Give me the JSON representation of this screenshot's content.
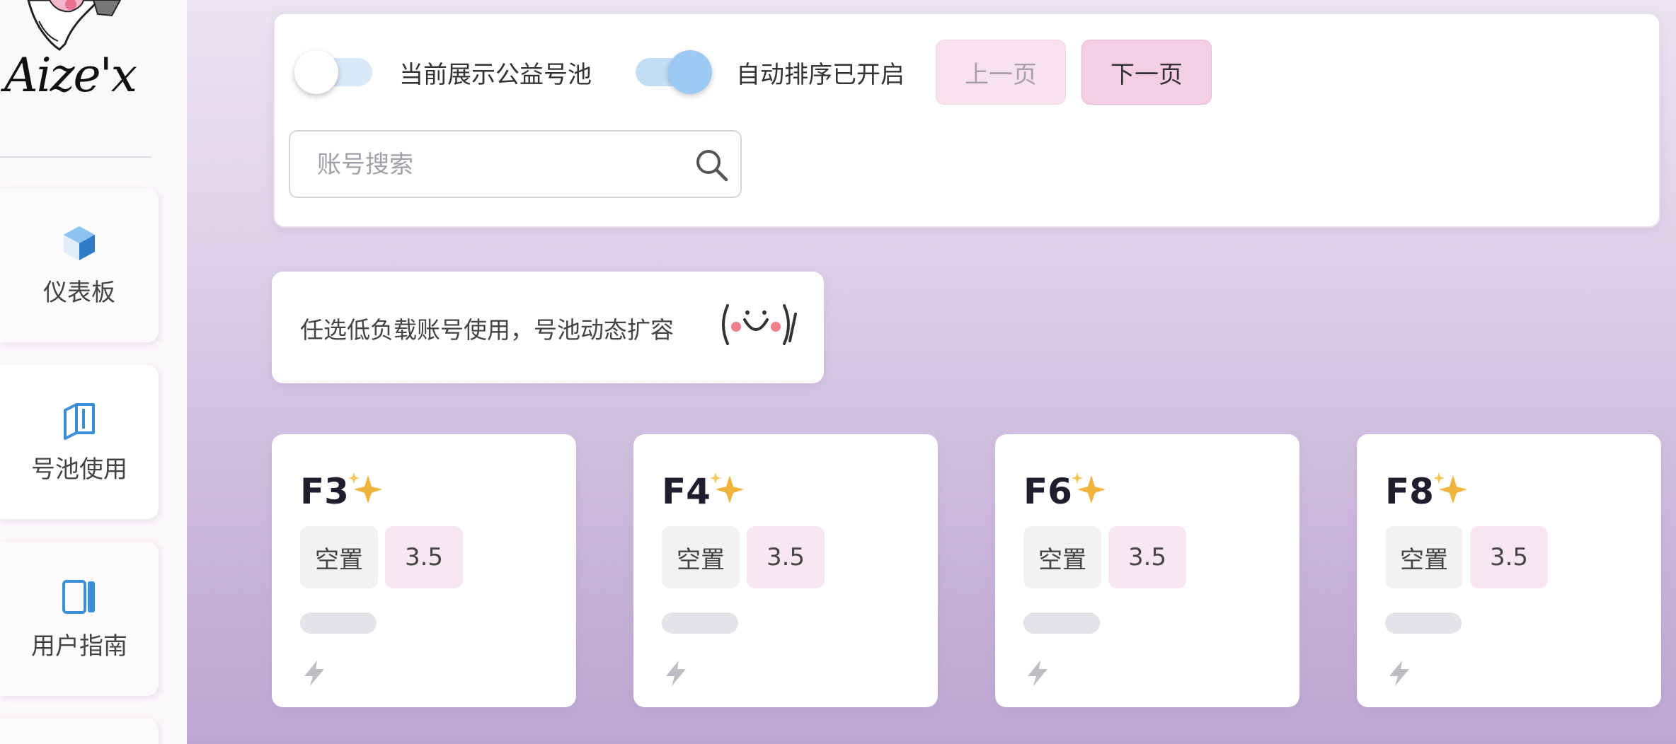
{
  "sidebar": {
    "logo_text": "Aize'x",
    "items": [
      {
        "label": "仪表板",
        "icon": "cube-icon"
      },
      {
        "label": "号池使用",
        "icon": "book-icon"
      },
      {
        "label": "用户指南",
        "icon": "guide-icon"
      }
    ]
  },
  "toolbar": {
    "public_pool_label": "当前展示公益号池",
    "public_pool_on": false,
    "auto_sort_label": "自动排序已开启",
    "auto_sort_on": true,
    "prev_label": "上一页",
    "next_label": "下一页",
    "search_placeholder": "账号搜索"
  },
  "notice": {
    "text": "任选低负载账号使用，号池动态扩容"
  },
  "cards": [
    {
      "name": "F3",
      "status": "空置",
      "version": "3.5"
    },
    {
      "name": "F4",
      "status": "空置",
      "version": "3.5"
    },
    {
      "name": "F6",
      "status": "空置",
      "version": "3.5"
    },
    {
      "name": "F8",
      "status": "空置",
      "version": "3.5"
    }
  ],
  "colors": {
    "accent_blue": "#9ccaf2",
    "pink_button": "#f4cee2",
    "icon_blue": "#3b8ed8",
    "sparkle_gold": "#f0b43c"
  }
}
